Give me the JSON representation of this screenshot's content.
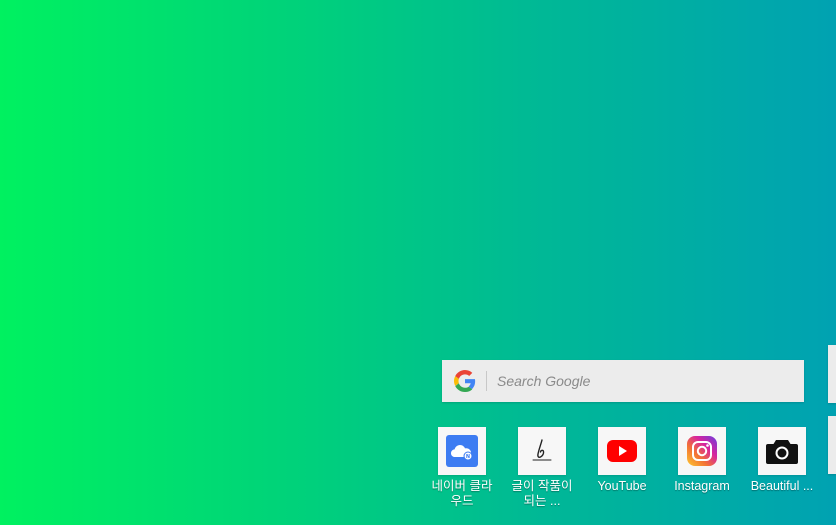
{
  "search": {
    "placeholder": "Search Google",
    "logo_colors": [
      "#4285F4",
      "#EA4335",
      "#FBBC05",
      "#34A853"
    ]
  },
  "apps": [
    {
      "label": "네이버 클라\n우드",
      "icon": "naver-cloud-icon",
      "color": "#3d7cf2"
    },
    {
      "label": "글이 작품이\n되는 ...",
      "icon": "pen-signature-icon",
      "color": "#222222"
    },
    {
      "label": "YouTube",
      "icon": "youtube-icon",
      "color": "#ff0000"
    },
    {
      "label": "Instagram",
      "icon": "instagram-icon",
      "color": "#d6249f"
    },
    {
      "label": "Beautiful ...",
      "icon": "camera-icon",
      "color": "#111111"
    }
  ],
  "background": {
    "gradient_start": "#00f160",
    "gradient_end": "#00a2b2"
  }
}
